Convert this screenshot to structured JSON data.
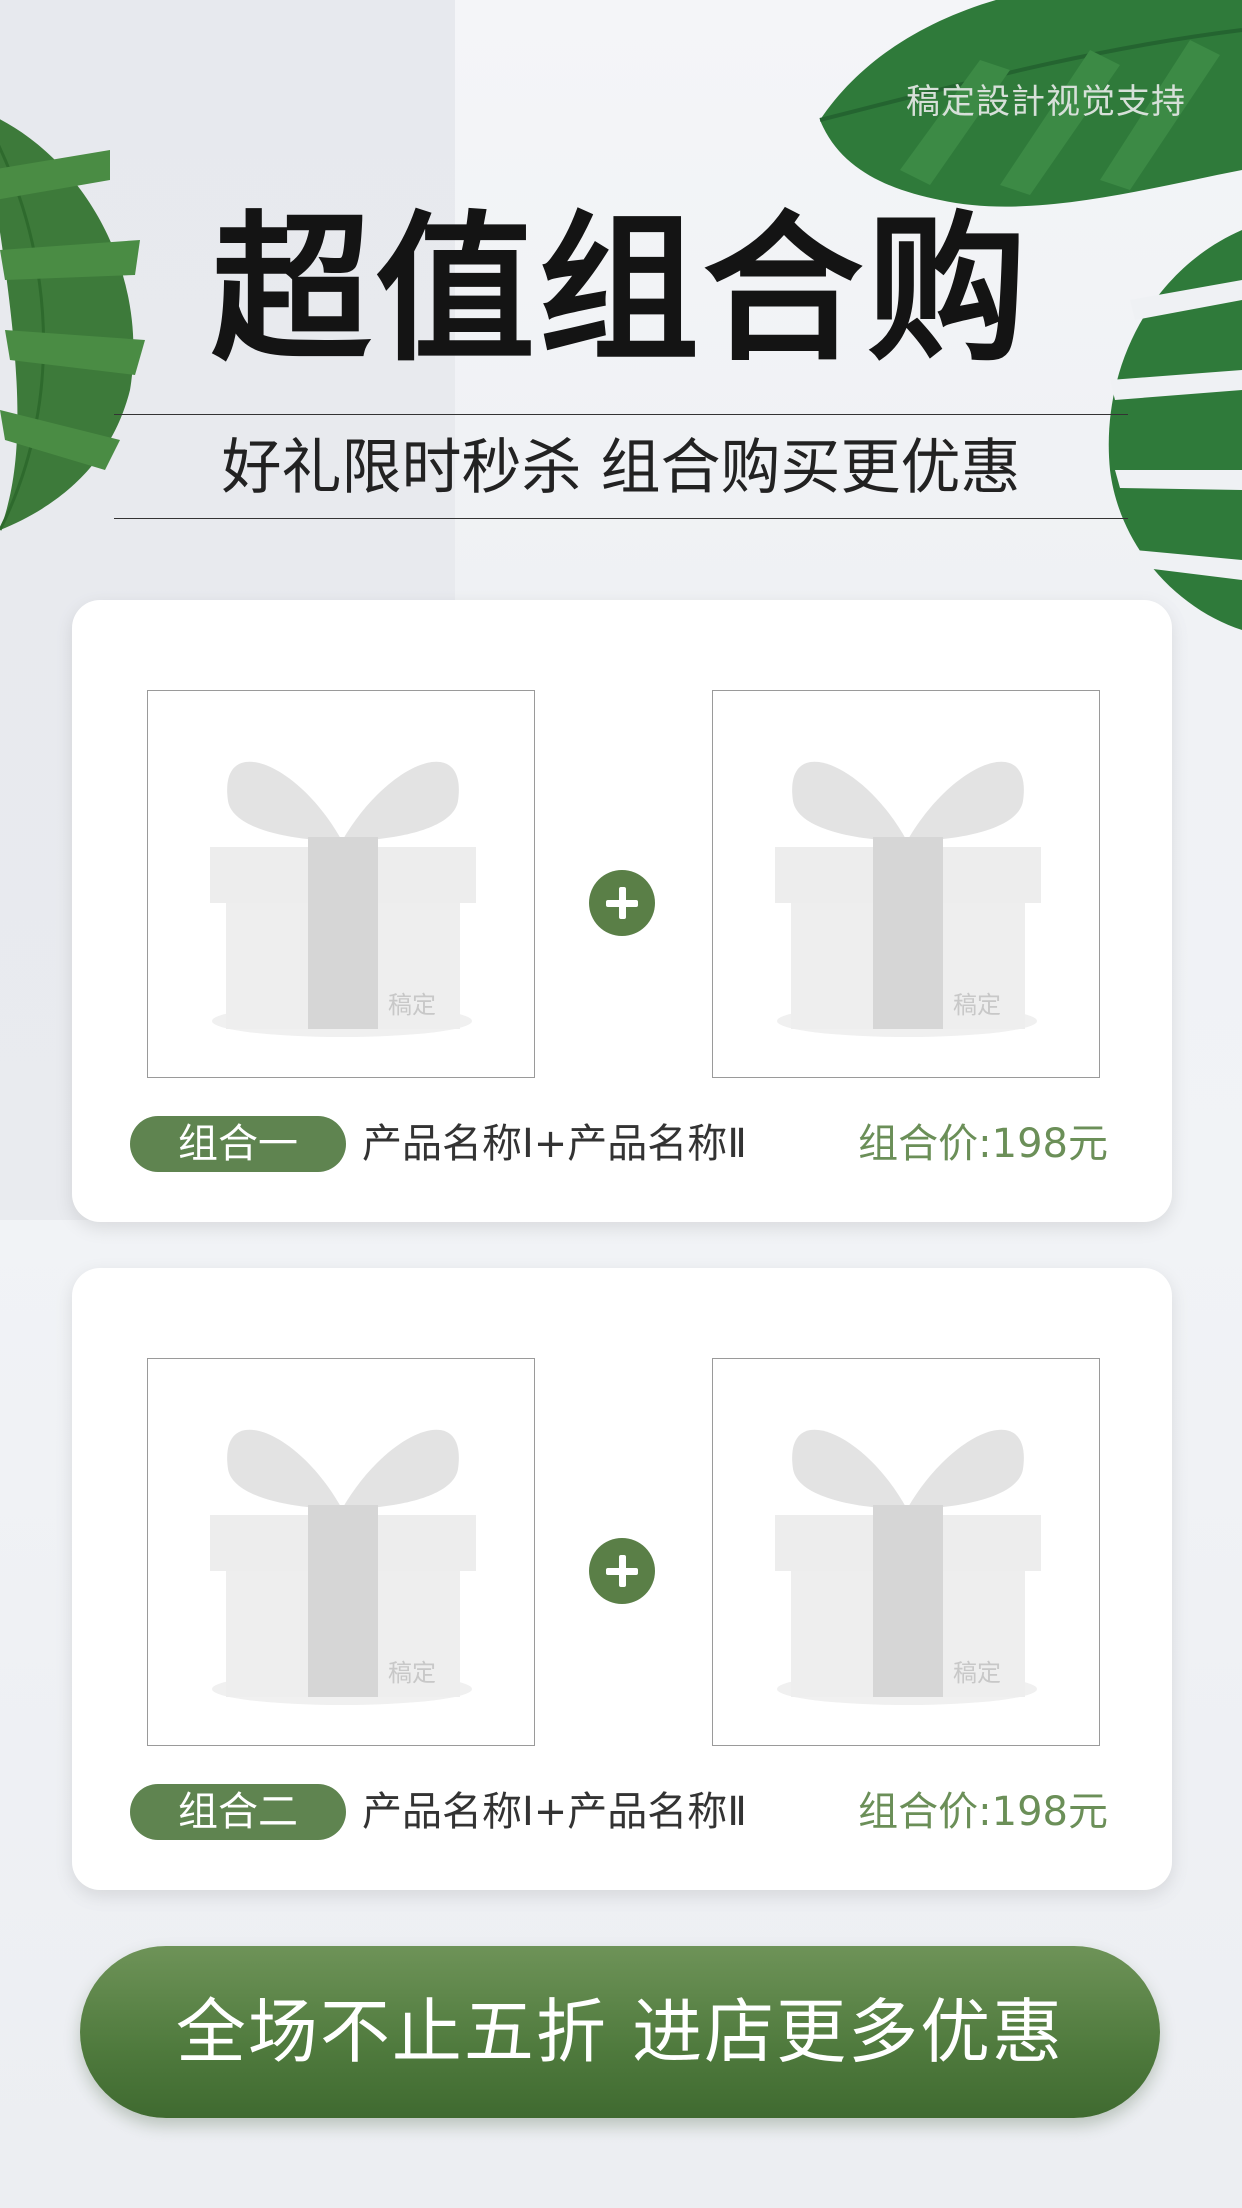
{
  "brand": {
    "watermark": "稿定設計视觉支持"
  },
  "header": {
    "title": "超值组合购",
    "subtitle": "好礼限时秒杀 组合购买更优惠"
  },
  "combos": [
    {
      "badge": "组合一",
      "products": "产品名称Ⅰ+产品名称Ⅱ",
      "price": "组合价:198元",
      "image_watermark": "稿定"
    },
    {
      "badge": "组合二",
      "products": "产品名称Ⅰ+产品名称Ⅱ",
      "price": "组合价:198元",
      "image_watermark": "稿定"
    }
  ],
  "cta": {
    "label": "全场不止五折 进店更多优惠"
  },
  "colors": {
    "accent_green": "#5f8450",
    "price_green": "#6b8f58",
    "title_black": "#141414"
  },
  "icons": [
    "plus-icon",
    "gift-box-icon",
    "tropical-leaf"
  ]
}
